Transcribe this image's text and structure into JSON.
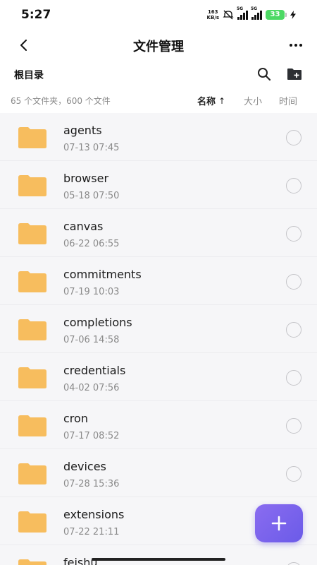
{
  "status": {
    "time": "5:27",
    "net_speed_value": "163",
    "net_speed_unit": "KB/s",
    "sim1": "5G",
    "sim2": "5G",
    "battery": "33"
  },
  "header": {
    "title": "文件管理"
  },
  "path": {
    "current": "根目录"
  },
  "summary": {
    "count_text": "65 个文件夹，600 个文件"
  },
  "sort": {
    "name_label": "名称",
    "name_arrow": "↑",
    "size_label": "大小",
    "time_label": "时间"
  },
  "files": [
    {
      "name": "agents",
      "date": "07-13 07:45"
    },
    {
      "name": "browser",
      "date": "05-18 07:50"
    },
    {
      "name": "canvas",
      "date": "06-22 06:55"
    },
    {
      "name": "commitments",
      "date": "07-19 10:03"
    },
    {
      "name": "completions",
      "date": "07-06 14:58"
    },
    {
      "name": "credentials",
      "date": "04-02 07:56"
    },
    {
      "name": "cron",
      "date": "07-17 08:52"
    },
    {
      "name": "devices",
      "date": "07-28 15:36"
    },
    {
      "name": "extensions",
      "date": "07-22 21:11"
    },
    {
      "name": "feishu",
      "date": ""
    }
  ],
  "colors": {
    "folder": "#f7bd5e",
    "fab": "#7a63ec"
  }
}
